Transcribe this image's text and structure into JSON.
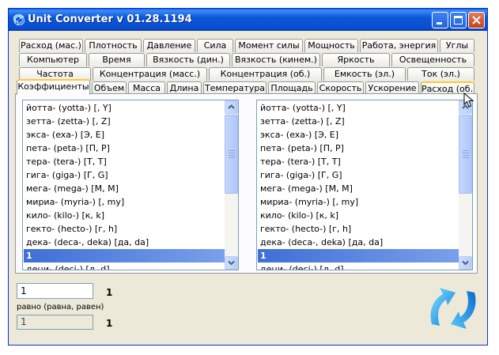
{
  "window": {
    "title": "Unit Converter v 01.28.1194"
  },
  "tabs": {
    "row1": [
      "Расход (мас.)",
      "Плотность",
      "Давление",
      "Сила",
      "Момент силы",
      "Мощность",
      "Работа, энергия",
      "Углы"
    ],
    "row2": [
      "Компьютер",
      "Время",
      "Вязкость (дин.)",
      "Вязкость (кинем.)",
      "Яркость",
      "Освещенность"
    ],
    "row3": [
      "Частота",
      "Концентрация (масс.)",
      "Концентрация (об.)",
      "Емкость (эл.)",
      "Ток (эл.)"
    ],
    "row4": [
      "Коэффициенты",
      "Объем",
      "Масса",
      "Длина",
      "Температура",
      "Площадь",
      "Скорость",
      "Ускорение",
      "Расход (об.)"
    ],
    "active": "Коэффициенты"
  },
  "left_list": {
    "items": [
      "йотта- (yotta-) [, Y]",
      "зетта- (zetta-) [, Z]",
      "экса- (exa-) [Э, E]",
      "пета- (peta-) [П, P]",
      "тера- (tera-) [Т, T]",
      "гига- (giga-) [Г, G]",
      "мега- (mega-) [М, M]",
      "мириа- (myria-) [, my]",
      "кило- (kilo-) [к, k]",
      "гекто- (hecto-) [г, h]",
      "дека- (deca-, deka) [да, da]",
      "1",
      "деци- (deci-) [д, d]"
    ],
    "selected": 11
  },
  "right_list": {
    "items": [
      "йотта- (yotta-) [, Y]",
      "зетта- (zetta-) [, Z]",
      "экса- (exa-) [Э, E]",
      "пета- (peta-) [П, P]",
      "тера- (tera-) [Т, T]",
      "гига- (giga-) [Г, G]",
      "мега- (mega-) [М, M]",
      "мириа- (myria-) [, my]",
      "кило- (kilo-) [к, k]",
      "гекто- (hecto-) [г, h]",
      "дека- (deca-, deka) [да, da]",
      "1",
      "деци- (deci-) [д, d]"
    ],
    "selected": 11
  },
  "input": {
    "value": "1",
    "label": "1"
  },
  "equals_label": "равно (равна, равен)",
  "result": {
    "value": "1",
    "label": "1"
  },
  "colors": {
    "title_blue": "#0a4ed0",
    "selection": "#3e6fd6",
    "tab_hot": "#ffc83c",
    "swap_icon": "#2aa0f0"
  },
  "icons": {
    "app": "converter-arrows-icon",
    "swap": "swap-arrows-icon",
    "minimize": "minimize-icon",
    "maximize": "maximize-icon",
    "close": "close-icon"
  }
}
